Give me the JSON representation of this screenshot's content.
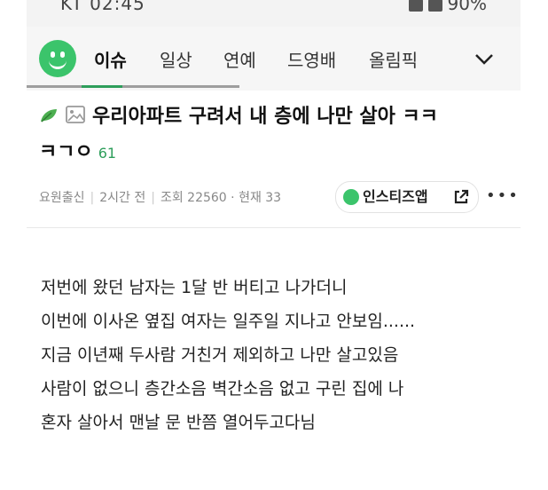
{
  "status_bar": {
    "left_text": "KT 02:45",
    "right_text": "90%"
  },
  "tabs": [
    {
      "label": "이슈",
      "active": true
    },
    {
      "label": "일상",
      "active": false
    },
    {
      "label": "연예",
      "active": false
    },
    {
      "label": "드영배",
      "active": false
    },
    {
      "label": "올림픽",
      "active": false
    }
  ],
  "post": {
    "title": "우리아파트 구려서 내 층에 나만 살아 ㅋㅋ",
    "title_line2": "ㅋㄱㅇ",
    "comment_count": "61",
    "author": "요원출신",
    "time": "2시간 전",
    "views": "조회 22560 · 현재 33",
    "app_button": "인스티즈앱",
    "body_lines": [
      "저번에 왔던 남자는 1달 반 버티고 나가더니",
      "이번에 이사온 옆집 여자는 일주일 지나고 안보임......",
      "지금 이년째 두사람 거친거 제외하고 나만 살고있음",
      "사람이 없으니 층간소음 벽간소음 없고 구린 집에 나",
      "혼자 살아서 맨날 문 반쯤 열어두고다님"
    ]
  },
  "colors": {
    "accent": "#2e9e5b",
    "logo": "#3bc46b"
  }
}
